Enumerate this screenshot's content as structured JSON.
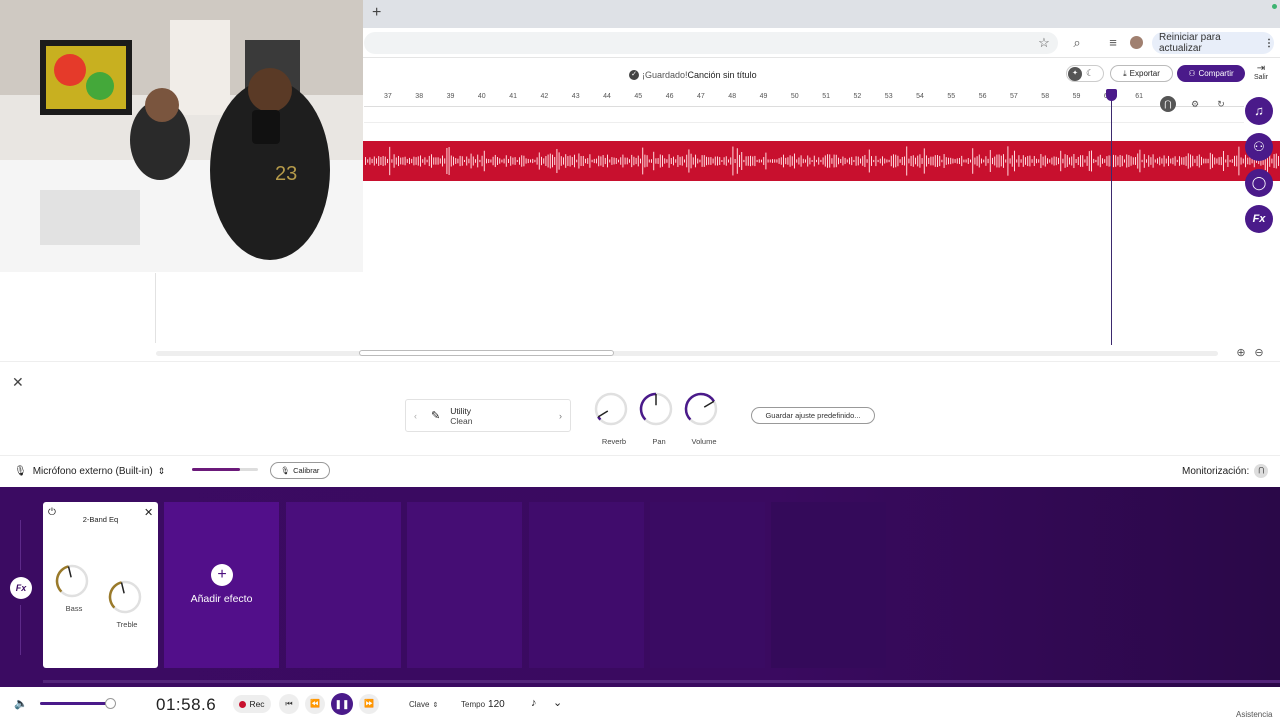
{
  "browser": {
    "new_tab_label": "+",
    "restart_label": "Reiniciar para actualizar"
  },
  "header": {
    "saved_label": "¡Guardado!",
    "song_title": "Canción sin título",
    "export_label": "Exportar",
    "share_label": "Compartir",
    "exit_label": "Salir"
  },
  "timeline": {
    "ruler_ticks": [
      "37",
      "38",
      "39",
      "40",
      "41",
      "42",
      "43",
      "44",
      "45",
      "46",
      "47",
      "48",
      "49",
      "50",
      "51",
      "52",
      "53",
      "54",
      "55",
      "56",
      "57",
      "58",
      "59",
      "60",
      "61"
    ],
    "track_color": "#c8102e"
  },
  "instrument_panel": {
    "preset_name": "Utility",
    "preset_sub": "Clean",
    "knobs": [
      {
        "label": "Reverb",
        "value": 0.05
      },
      {
        "label": "Pan",
        "value": 0.5
      },
      {
        "label": "Volume",
        "value": 0.72
      }
    ],
    "save_preset_label": "Guardar ajuste predefinido...",
    "mic_label": "Micrófono externo (Built-in)",
    "input_level": 0.72,
    "calibrate_label": "Calibrar",
    "monitor_label": "Monitorización:"
  },
  "fx_rack": {
    "badge": "Fx",
    "effect_card": {
      "title": "2-Band Eq",
      "knobs": [
        {
          "label": "Bass",
          "value": 0.45
        },
        {
          "label": "Treble",
          "value": 0.45
        }
      ]
    },
    "add_effect_label": "Añadir efecto"
  },
  "transport": {
    "volume_level": 0.9,
    "time": "01:58.6",
    "rec_label": "Rec",
    "key_label": "Clave",
    "tempo_label": "Tempo",
    "tempo_value": "120",
    "assist_label": "Asistencia"
  },
  "colors": {
    "accent": "#4a1a8a",
    "rack_bg": "#3b0b62",
    "track": "#c8102e"
  }
}
